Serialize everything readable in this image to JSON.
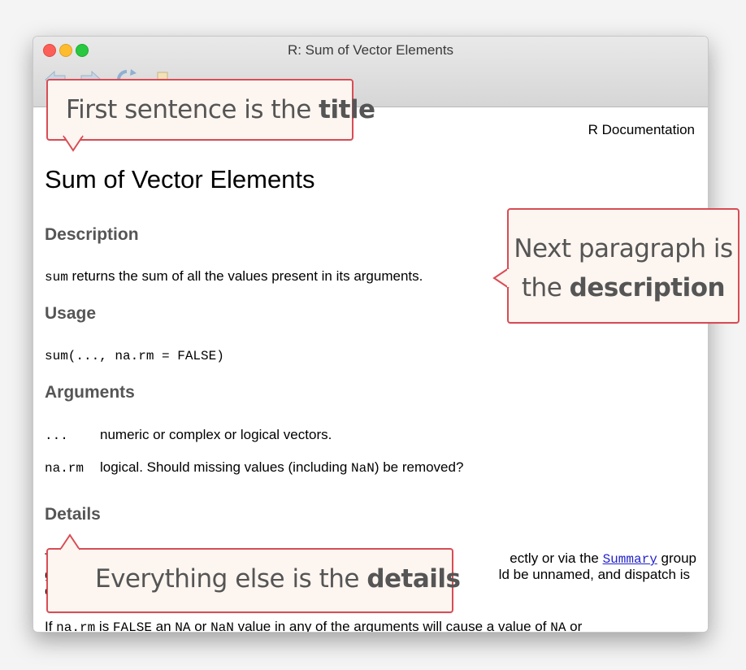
{
  "window": {
    "title": "R: Sum of Vector Elements"
  },
  "doc": {
    "top_right": "R Documentation",
    "title": "Sum of Vector Elements",
    "description": {
      "heading": "Description",
      "code_word": "sum",
      "text": " returns the sum of all the values present in its arguments."
    },
    "usage": {
      "heading": "Usage",
      "code": "sum(..., na.rm = FALSE)"
    },
    "arguments": {
      "heading": "Arguments",
      "items": [
        {
          "name": "...",
          "pre": "numeric or complex or logical vectors.",
          "code": "",
          "post": ""
        },
        {
          "name": "na.rm",
          "pre": "logical. Should missing values (including ",
          "code": "NaN",
          "post": ") be removed?"
        }
      ]
    },
    "details": {
      "heading": "Details",
      "line1_a": "T",
      "line1_b": "ectly or via the ",
      "line1_link": "Summary",
      "line1_c": " group",
      "line2_a": "g",
      "line2_b": "ld be unnamed, and dispatch is",
      "line3_a": "c",
      "line4": [
        {
          "t": "If ",
          "c": false
        },
        {
          "t": "na.rm",
          "c": true
        },
        {
          "t": " is ",
          "c": false
        },
        {
          "t": "FALSE",
          "c": true
        },
        {
          "t": " an ",
          "c": false
        },
        {
          "t": "NA",
          "c": true
        },
        {
          "t": " or ",
          "c": false
        },
        {
          "t": "NaN",
          "c": true
        },
        {
          "t": " value in any of the arguments will cause a value of ",
          "c": false
        },
        {
          "t": "NA",
          "c": true
        },
        {
          "t": " or",
          "c": false
        }
      ]
    }
  },
  "callouts": {
    "title": {
      "pre": "First sentence is the ",
      "bold": "title"
    },
    "description": {
      "line1": "Next paragraph is",
      "pre2": "the ",
      "bold": "description"
    },
    "details": {
      "pre": "Everything else is the ",
      "bold": "details"
    }
  },
  "icons": {
    "back": "back-arrow-icon",
    "forward": "forward-arrow-icon",
    "reload": "reload-icon",
    "bookmark": "bookmark-icon"
  },
  "colors": {
    "callout_border": "#d94c55",
    "callout_fill": "#fdf5f0",
    "link": "#2222cc"
  }
}
